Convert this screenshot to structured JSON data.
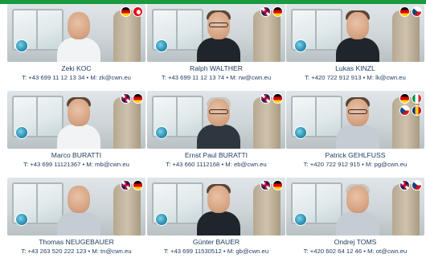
{
  "accent_color": "#1a9a3f",
  "text_color": "#1e3a5c",
  "people": [
    {
      "name": "Zeki KOC",
      "contact": "T: +43 699 11 12 13 34 • M: zk@cwn.eu",
      "flags": [
        "de",
        "tr"
      ]
    },
    {
      "name": "Ralph WALTHER",
      "contact": "T: +43 699 11 12 13 74 • M: rw@cwn.eu",
      "flags": [
        "gb",
        "de"
      ]
    },
    {
      "name": "Lukas KINZL",
      "contact": "T: +420 722 912 913 • M: lk@cwn.eu",
      "flags": [
        "de",
        "cz"
      ]
    },
    {
      "name": "Marco BURATTI",
      "contact": "T: +43 699 11121367 • M: mb@cwn.eu",
      "flags": [
        "gb",
        "de"
      ]
    },
    {
      "name": "Ernst Paul BURATTI",
      "contact": "T: +43 660 1112168 • M: eb@cwn.eu",
      "flags": [
        "gb",
        "de"
      ]
    },
    {
      "name": "Patrick GEHLFUSS",
      "contact": "T: +420 722 912 915 • M: pg@cwn.eu",
      "flags": [
        "de",
        "it",
        "cz",
        "ro"
      ]
    },
    {
      "name": "Thomas NEUGEBAUER",
      "contact": "T: +43 263 520 222 123 • M: tn@cwn.eu",
      "flags": [
        "gb",
        "de"
      ]
    },
    {
      "name": "Günter BAUER",
      "contact": "T: +43 699 11530512 • M: gb@cwn.eu",
      "flags": [
        "gb",
        "de"
      ]
    },
    {
      "name": "Ondrej TOMS",
      "contact": "T: +420 602 64 12 46 • M: ot@cwn.eu",
      "flags": [
        "gb",
        "cz"
      ]
    }
  ]
}
